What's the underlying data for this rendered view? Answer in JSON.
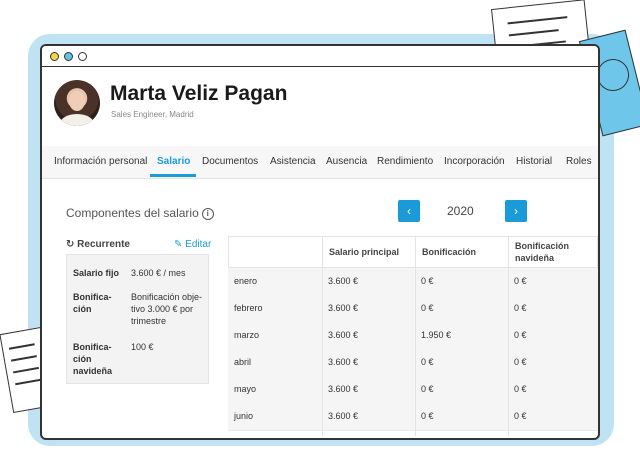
{
  "profile": {
    "name": "Marta Veliz Pagan",
    "subtitle": "Sales Engineer, Madrid"
  },
  "tabs": [
    {
      "label": "Información personal"
    },
    {
      "label": "Salario",
      "active": true
    },
    {
      "label": "Documentos"
    },
    {
      "label": "Asistencia"
    },
    {
      "label": "Ausencia"
    },
    {
      "label": "Rendimiento"
    },
    {
      "label": "Incorporación"
    },
    {
      "label": "Historial"
    },
    {
      "label": "Roles"
    }
  ],
  "salary": {
    "section_title": "Componentes del salario",
    "year": "2020",
    "prev_icon": "chevron-left-icon",
    "next_icon": "chevron-right-icon",
    "recurrente_label": "Recurrente",
    "edit_label": "Editar",
    "components": [
      {
        "label": [
          "Salario fijo"
        ],
        "value": [
          "3.600 € / mes"
        ]
      },
      {
        "label": [
          "Bonifica-",
          "ción"
        ],
        "value": [
          "Bonificación obje-",
          "tivo 3.000 € por",
          "trimestre"
        ]
      },
      {
        "label": [
          "Bonifica-",
          "ción",
          "navideña"
        ],
        "value": [
          "100 €"
        ]
      }
    ],
    "table": {
      "headers": [
        "",
        "Salario principal",
        "Bonificación",
        "Bonificación navideña"
      ],
      "header_lines": [
        [
          ""
        ],
        [
          "Salario principal"
        ],
        [
          "Bonificación"
        ],
        [
          "Bonificación",
          "navideña"
        ]
      ],
      "rows": [
        [
          "enero",
          "3.600 €",
          "0 €",
          "0 €"
        ],
        [
          "febrero",
          "3.600 €",
          "0 €",
          "0 €"
        ],
        [
          "marzo",
          "3.600 €",
          "1.950 €",
          "0 €"
        ],
        [
          "abril",
          "3.600 €",
          "0 €",
          "0 €"
        ],
        [
          "mayo",
          "3.600 €",
          "0 €",
          "0 €"
        ],
        [
          "junio",
          "3.600 €",
          "0 €",
          "0 €"
        ]
      ]
    }
  },
  "colors": {
    "accent": "#1a9bd7",
    "backdrop": "#bfe3f2",
    "window_dot_yellow": "#f6d443",
    "window_dot_blue": "#5fc4e8"
  }
}
